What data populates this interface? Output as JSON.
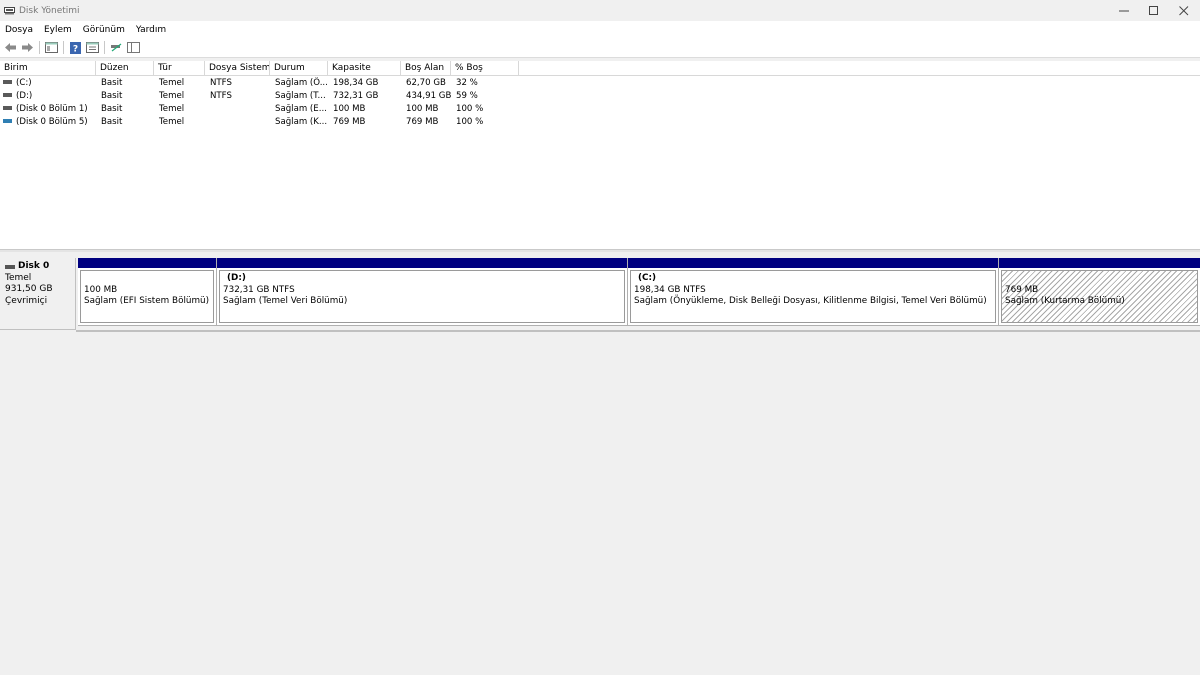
{
  "window": {
    "title": "Disk Yönetimi",
    "controls": {
      "minimize": "—",
      "maximize": "☐",
      "close": "✕"
    }
  },
  "menu": [
    "Dosya",
    "Eylem",
    "Görünüm",
    "Yardım"
  ],
  "toolbar": {
    "buttons": [
      "back-icon",
      "forward-icon",
      "properties-icon",
      "help-icon",
      "list-view-icon",
      "rescan-icon",
      "console-icon"
    ]
  },
  "volume_list": {
    "columns": [
      "Birim",
      "Düzen",
      "Tür",
      "Dosya Sistemi",
      "Durum",
      "Kapasite",
      "Boş Alan",
      "% Boş"
    ],
    "rows": [
      {
        "name": "(C:)",
        "layout": "Basit",
        "type": "Temel",
        "fs": "NTFS",
        "status": "Sağlam (Ö...",
        "capacity": "198,34 GB",
        "free": "62,70 GB",
        "pct": "32 %",
        "icon": "drive-icon"
      },
      {
        "name": "(D:)",
        "layout": "Basit",
        "type": "Temel",
        "fs": "NTFS",
        "status": "Sağlam (T...",
        "capacity": "732,31 GB",
        "free": "434,91 GB",
        "pct": "59 %",
        "icon": "drive-icon"
      },
      {
        "name": "(Disk 0 Bölüm 1)",
        "layout": "Basit",
        "type": "Temel",
        "fs": "",
        "status": "Sağlam (E...",
        "capacity": "100 MB",
        "free": "100 MB",
        "pct": "100 %",
        "icon": "drive-icon"
      },
      {
        "name": "(Disk 0 Bölüm 5)",
        "layout": "Basit",
        "type": "Temel",
        "fs": "",
        "status": "Sağlam (K...",
        "capacity": "769 MB",
        "free": "769 MB",
        "pct": "100 %",
        "icon": "recovery-drive-icon"
      }
    ]
  },
  "disk": {
    "name": "Disk 0",
    "type": "Temel",
    "size": "931,50 GB",
    "status": "Çevrimiçi",
    "partitions": [
      {
        "label": "",
        "size": "100 MB",
        "status": "Sağlam (EFI Sistem Bölümü)",
        "hatched": false
      },
      {
        "label": "(D:)",
        "size": "732,31 GB NTFS",
        "status": "Sağlam (Temel Veri Bölümü)",
        "hatched": false
      },
      {
        "label": "(C:)",
        "size": "198,34 GB NTFS",
        "status": "Sağlam (Önyükleme, Disk Belleği Dosyası, Kilitlenme Bilgisi, Temel Veri Bölümü)",
        "hatched": false
      },
      {
        "label": "",
        "size": "769 MB",
        "status": "Sağlam (Kurtarma Bölümü)",
        "hatched": true
      }
    ]
  },
  "colors": {
    "partition_bar": "#000080",
    "recovery_icon": "#2f7fb3"
  }
}
